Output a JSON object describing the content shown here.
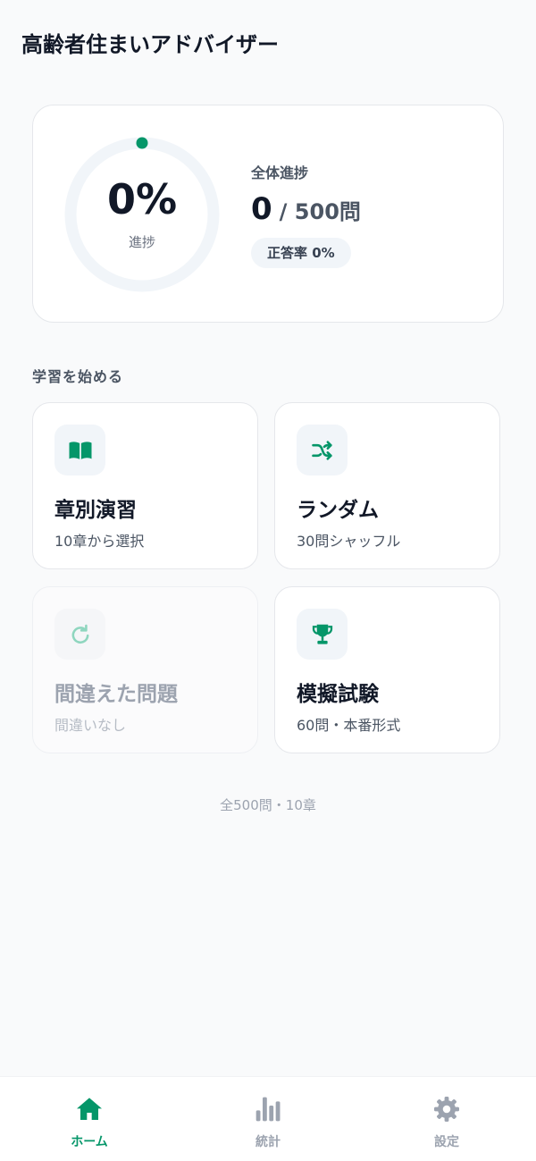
{
  "app": {
    "title": "高齢者住まいアドバイザー"
  },
  "progress": {
    "percent_text": "0%",
    "percent_value": 0,
    "ring_label": "進捗",
    "overall_label": "全体進捗",
    "answered": "0",
    "total_text": "/ 500問",
    "accuracy_text": "正答率 0%"
  },
  "study": {
    "heading": "学習を始める",
    "modes": [
      {
        "title": "章別演習",
        "subtitle": "10章から選択",
        "icon": "book-icon",
        "enabled": true
      },
      {
        "title": "ランダム",
        "subtitle": "30問シャッフル",
        "icon": "shuffle-icon",
        "enabled": true
      },
      {
        "title": "間違えた問題",
        "subtitle": "間違いなし",
        "icon": "refresh-icon",
        "enabled": false
      },
      {
        "title": "模擬試験",
        "subtitle": "60問・本番形式",
        "icon": "trophy-icon",
        "enabled": true
      }
    ]
  },
  "footer": {
    "note": "全500問・10章"
  },
  "nav": {
    "items": [
      {
        "label": "ホーム",
        "icon": "home-icon",
        "active": true
      },
      {
        "label": "統計",
        "icon": "bar-chart-icon",
        "active": false
      },
      {
        "label": "設定",
        "icon": "gear-icon",
        "active": false
      }
    ]
  },
  "colors": {
    "accent": "#059669",
    "text_primary": "#111827",
    "text_secondary": "#4b5563",
    "muted": "#9ca3af",
    "ring_track": "#f1f5f9"
  }
}
